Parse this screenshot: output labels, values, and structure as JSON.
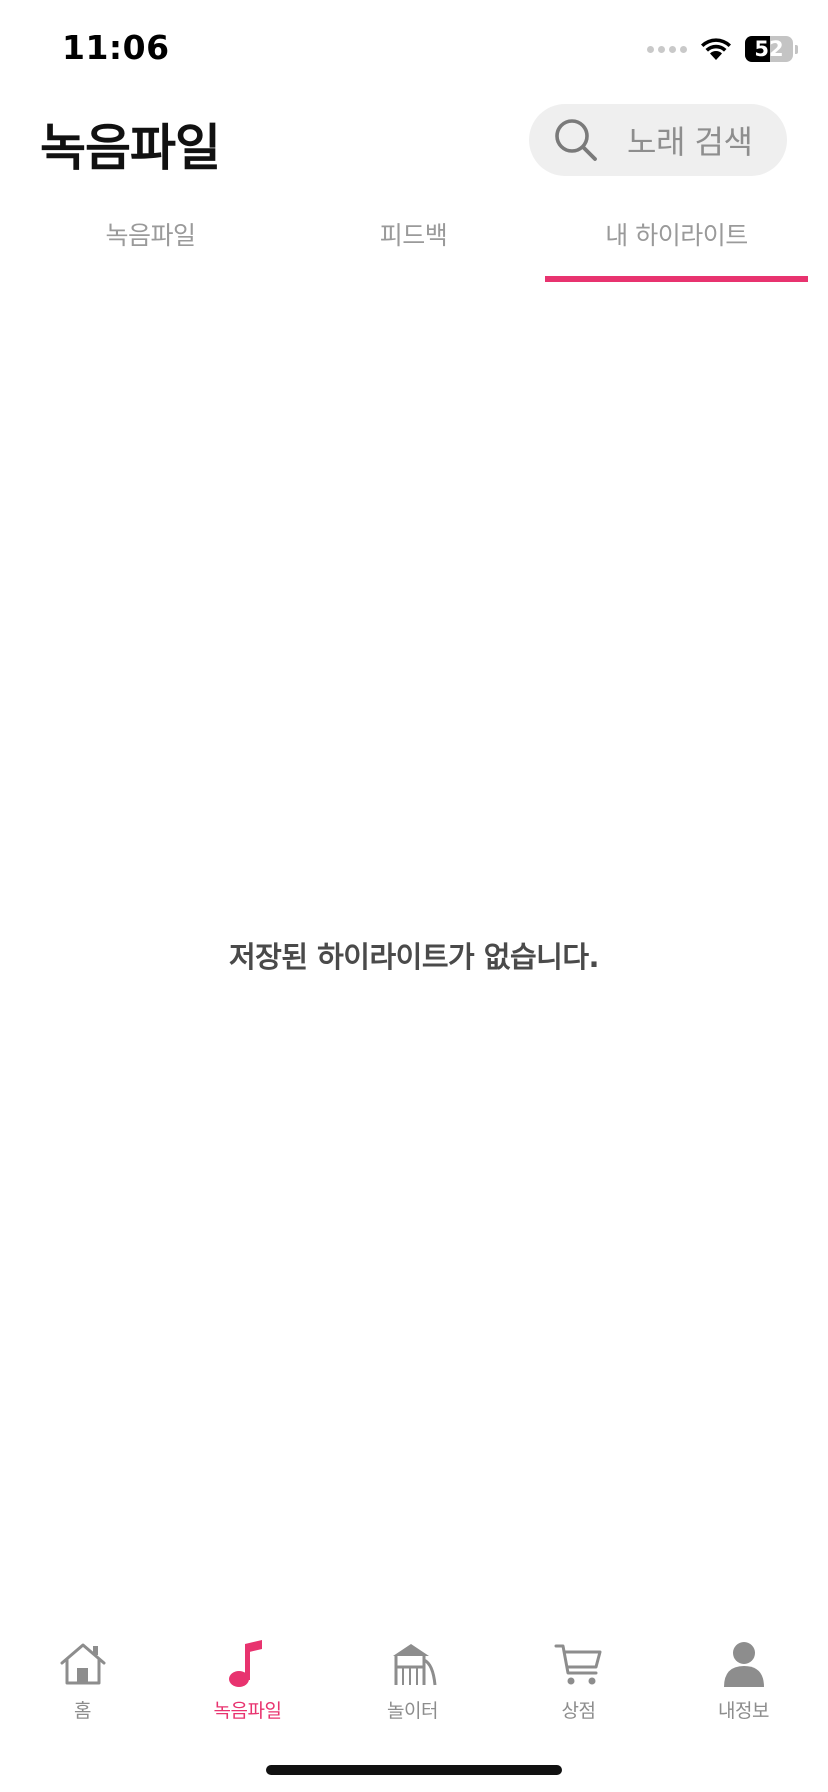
{
  "status_bar": {
    "time": "11:06",
    "battery": "52"
  },
  "header": {
    "title": "녹음파일",
    "search_placeholder": "노래 검색"
  },
  "tabs": [
    {
      "label": "녹음파일"
    },
    {
      "label": "피드백"
    },
    {
      "label": "내 하이라이트"
    }
  ],
  "active_tab": "내 하이라이트",
  "empty_state": {
    "message": "저장된 하이라이트가 없습니다."
  },
  "bottom_nav": [
    {
      "label": "홈",
      "icon": "home-icon"
    },
    {
      "label": "녹음파일",
      "icon": "music-note-icon"
    },
    {
      "label": "놀이터",
      "icon": "playground-icon"
    },
    {
      "label": "상점",
      "icon": "cart-icon"
    },
    {
      "label": "내정보",
      "icon": "profile-icon"
    }
  ],
  "colors": {
    "accent": "#e8336f",
    "inactive": "#8d8d8d",
    "search_bg": "#efefef"
  }
}
